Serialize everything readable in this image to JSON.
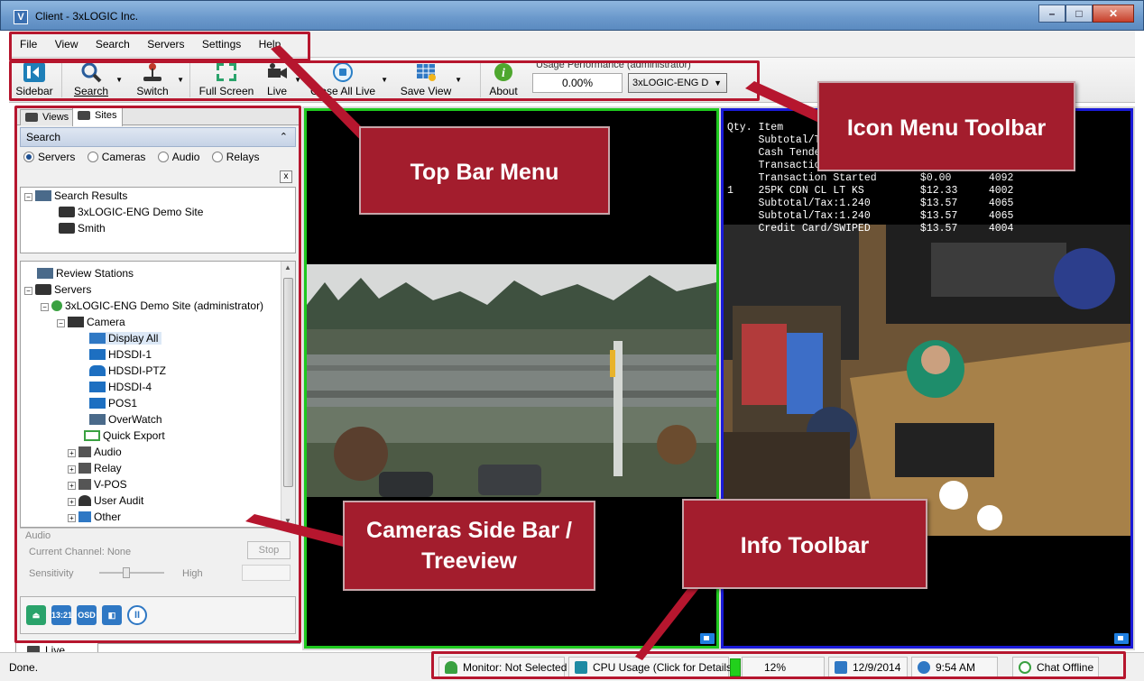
{
  "window": {
    "title": "Client - 3xLOGIC Inc."
  },
  "menu": [
    "File",
    "View",
    "Search",
    "Servers",
    "Settings",
    "Help"
  ],
  "toolbar": {
    "sidebar": "Sidebar",
    "search": "Search",
    "switch": "Switch",
    "fullscreen": "Full Screen",
    "live": "Live",
    "close_all_live": "Close All Live",
    "save_view": "Save View",
    "about": "About",
    "usage_label": "Usage Performance (administrator)",
    "usage_value": "0.00%",
    "server_select": "3xLOGIC-ENG D"
  },
  "sidebar": {
    "tabs": [
      "Views",
      "Sites"
    ],
    "search_header": "Search",
    "radios": [
      "Servers",
      "Cameras",
      "Audio",
      "Relays"
    ],
    "selected_radio": "Servers",
    "clear_label": "x",
    "results": [
      "Search Results",
      "3xLOGIC-ENG Demo Site",
      "Smith"
    ],
    "tree": {
      "review_stations": "Review Stations",
      "servers": "Servers",
      "site": "3xLOGIC-ENG Demo Site (administrator)",
      "camera": "Camera",
      "cameras": [
        "Display All",
        "HDSDI-1",
        "HDSDI-PTZ",
        "HDSDI-4",
        "POS1",
        "OverWatch"
      ],
      "quick_export": "Quick Export",
      "nodes": [
        "Audio",
        "Relay",
        "V-POS",
        "User Audit",
        "Other"
      ]
    },
    "audio": {
      "title": "Audio",
      "channel": "Current Channel: None",
      "stop": "Stop",
      "sensitivity": "Sensitivity",
      "high": "High"
    },
    "quick_buttons": [
      "13:21",
      "OSD"
    ],
    "live_tab": "Live"
  },
  "pos_overlay": {
    "lines": [
      "Qty. Item",
      "     Subtotal/T",
      "     Cash Tende",
      "     Transaction",
      "     Transaction Started       $0.00      4092",
      "1    25PK CDN CL LT KS         $12.33     4002",
      "     Subtotal/Tax:1.240        $13.57     4065",
      "     Subtotal/Tax:1.240        $13.57     4065",
      "     Credit Card/SWIPED        $13.57     4004"
    ]
  },
  "status": {
    "done": "Done.",
    "monitor": "Monitor: Not Selected",
    "cpu": "CPU Usage (Click for Details) :",
    "cpu_pct": "12%",
    "date": "12/9/2014",
    "time": "9:54 AM",
    "chat": "Chat Offline"
  },
  "callouts": {
    "top_bar": "Top Bar Menu",
    "icon_toolbar": "Icon Menu Toolbar",
    "side_bar_1": "Cameras Side Bar /",
    "side_bar_2": "Treeview",
    "info_toolbar": "Info Toolbar"
  },
  "colors": {
    "callout": "#a31d2d",
    "highlight": "#b6162e",
    "pane_left_border": "#1ec81e",
    "pane_right_border": "#1a1ad8"
  }
}
